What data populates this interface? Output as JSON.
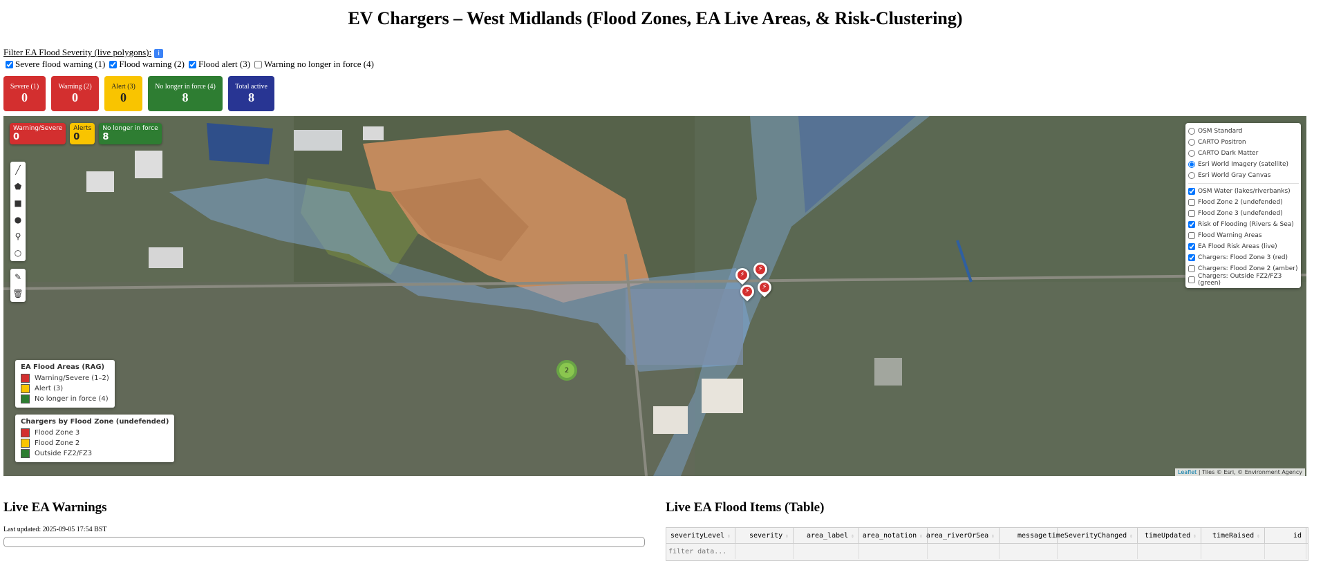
{
  "title": "EV Chargers – West Midlands (Flood Zones, EA Live Areas, & Risk-Clustering)",
  "filter": {
    "label": "Filter EA Flood Severity (live polygons):",
    "info_icon": "info-icon",
    "options": [
      {
        "label": "Severe flood warning (1)",
        "checked": true
      },
      {
        "label": "Flood warning (2)",
        "checked": true
      },
      {
        "label": "Flood alert (3)",
        "checked": true
      },
      {
        "label": "Warning no longer in force (4)",
        "checked": false
      }
    ]
  },
  "cards": [
    {
      "label": "Severe (1)",
      "value": "0",
      "color": "#d32f2f"
    },
    {
      "label": "Warning (2)",
      "value": "0",
      "color": "#d32f2f"
    },
    {
      "label": "Alert (3)",
      "value": "0",
      "color": "#f9c400"
    },
    {
      "label": "No longer in force (4)",
      "value": "8",
      "color": "#2e7d32"
    },
    {
      "label": "Total active",
      "value": "8",
      "color": "#283593"
    }
  ],
  "map": {
    "rag": [
      {
        "label": "Warning/Severe",
        "value": "0",
        "color": "#d32f2f"
      },
      {
        "label": "Alerts",
        "value": "0",
        "color": "#f9c400"
      },
      {
        "label": "No longer in force",
        "value": "8",
        "color": "#2e7d32"
      }
    ],
    "base_layers": [
      {
        "label": "OSM Standard",
        "checked": false
      },
      {
        "label": "CARTO Positron",
        "checked": false
      },
      {
        "label": "CARTO Dark Matter",
        "checked": false
      },
      {
        "label": "Esri World Imagery (satellite)",
        "checked": true
      },
      {
        "label": "Esri World Gray Canvas",
        "checked": false
      }
    ],
    "overlays": [
      {
        "label": "OSM Water (lakes/riverbanks)",
        "checked": true
      },
      {
        "label": "Flood Zone 2 (undefended)",
        "checked": false
      },
      {
        "label": "Flood Zone 3 (undefended)",
        "checked": false
      },
      {
        "label": "Risk of Flooding (Rivers & Sea)",
        "checked": true
      },
      {
        "label": "Flood Warning Areas",
        "checked": false
      },
      {
        "label": "EA Flood Risk Areas (live)",
        "checked": true
      },
      {
        "label": "Chargers: Flood Zone 3 (red)",
        "checked": true
      },
      {
        "label": "Chargers: Flood Zone 2 (amber)",
        "checked": false
      },
      {
        "label": "Chargers: Outside FZ2/FZ3 (green)",
        "checked": false
      }
    ],
    "legend_ea": {
      "title": "EA Flood Areas (RAG)",
      "items": [
        {
          "label": "Warning/Severe (1–2)",
          "color": "#d32f2f"
        },
        {
          "label": "Alert (3)",
          "color": "#f9c400"
        },
        {
          "label": "No longer in force (4)",
          "color": "#2e7d32"
        }
      ]
    },
    "legend_chargers": {
      "title": "Chargers by Flood Zone (undefended)",
      "items": [
        {
          "label": "Flood Zone 3",
          "color": "#d32f2f"
        },
        {
          "label": "Flood Zone 2",
          "color": "#f9c400"
        },
        {
          "label": "Outside FZ2/FZ3",
          "color": "#2e7d32"
        }
      ]
    },
    "cluster_count": "2",
    "attribution_link": "Leaflet",
    "attribution_text": "| Tiles © Esri, © Environment Agency"
  },
  "warnings": {
    "title": "Live EA Warnings",
    "updated": "Last updated: 2025-09-05 17:54 BST"
  },
  "table": {
    "title": "Live EA Flood Items (Table)",
    "columns": [
      "severityLevel",
      "severity",
      "area_label",
      "area_notation",
      "area_riverOrSea",
      "message",
      "timeSeverityChanged",
      "timeUpdated",
      "timeRaised",
      "id"
    ],
    "filter_placeholder": "filter data..."
  }
}
